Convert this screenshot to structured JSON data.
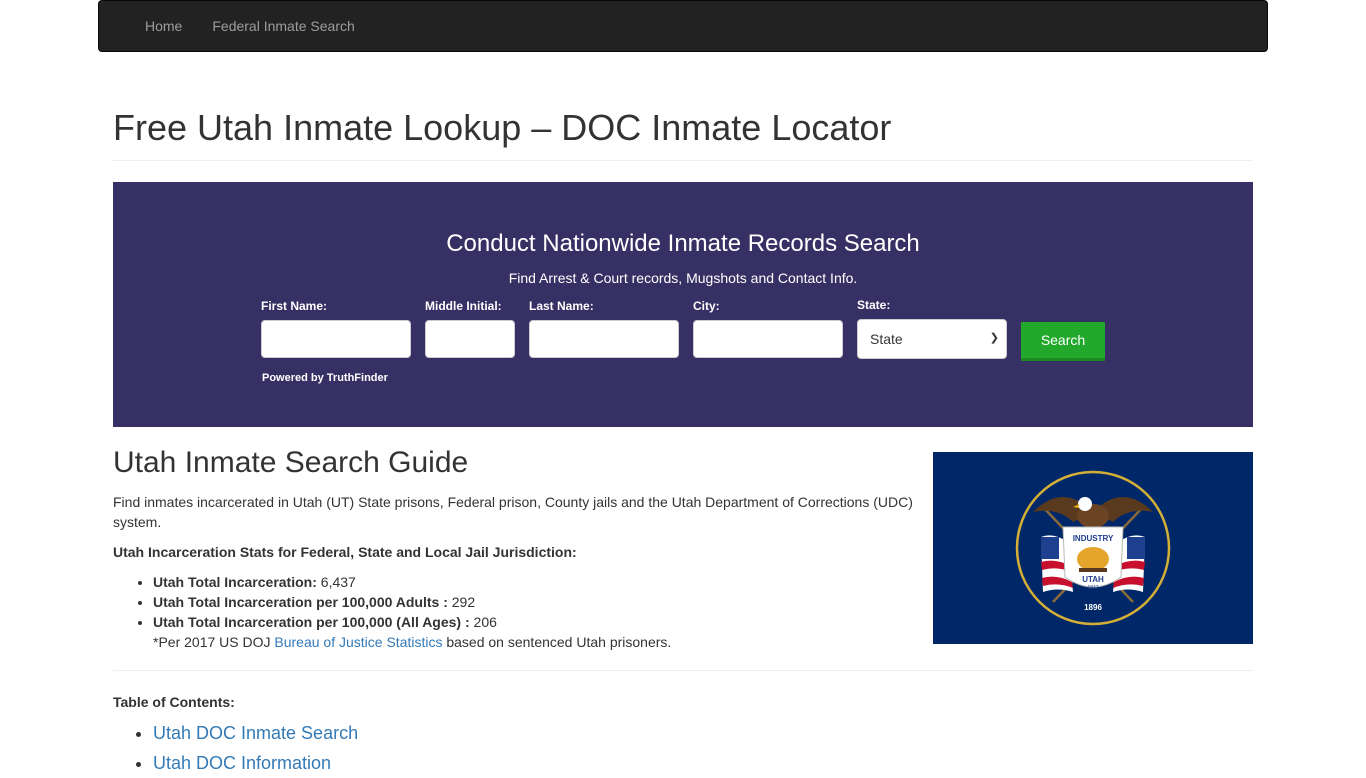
{
  "nav": {
    "items": [
      {
        "label": "Home"
      },
      {
        "label": "Federal Inmate Search"
      }
    ]
  },
  "page": {
    "title": "Free Utah Inmate Lookup – DOC Inmate Locator"
  },
  "search_widget": {
    "title": "Conduct Nationwide Inmate Records Search",
    "subtitle": "Find Arrest & Court records, Mugshots and Contact Info.",
    "fields": {
      "first_name": {
        "label": "First Name:",
        "value": ""
      },
      "middle_initial": {
        "label": "Middle Initial:",
        "value": ""
      },
      "last_name": {
        "label": "Last Name:",
        "value": ""
      },
      "city": {
        "label": "City:",
        "value": ""
      },
      "state": {
        "label": "State:",
        "selected": "State"
      }
    },
    "search_button": "Search",
    "powered_by": "Powered by TruthFinder",
    "colors": {
      "background": "#373064",
      "button": "#22a92b"
    }
  },
  "guide": {
    "heading": "Utah Inmate Search Guide",
    "intro": "Find inmates incarcerated in Utah (UT) State prisons, Federal prison, County jails and the Utah Department of Corrections (UDC) system.",
    "stats_heading": "Utah Incarceration Stats for Federal, State and Local Jail Jurisdiction:",
    "stats": [
      {
        "label": "Utah Total Incarceration:",
        "value": "6,437"
      },
      {
        "label": "Utah Total Incarceration per 100,000 Adults :",
        "value": "292"
      },
      {
        "label": "Utah Total Incarceration per 100,000 (All Ages) :",
        "value": "206"
      }
    ],
    "note_prefix": "*Per 2017 US DOJ ",
    "note_link": "Bureau of Justice Statistics",
    "note_suffix": " based on sentenced Utah prisoners."
  },
  "flag": {
    "alt": "Utah state flag",
    "banner_text": "INDUSTRY",
    "shield_text": "UTAH",
    "shield_year": "1847",
    "year": "1896",
    "colors": {
      "field": "#002868",
      "ring": "#d4af37"
    }
  },
  "toc": {
    "heading": "Table of Contents:",
    "items": [
      {
        "label": "Utah DOC Inmate Search"
      },
      {
        "label": "Utah DOC Information"
      }
    ]
  }
}
